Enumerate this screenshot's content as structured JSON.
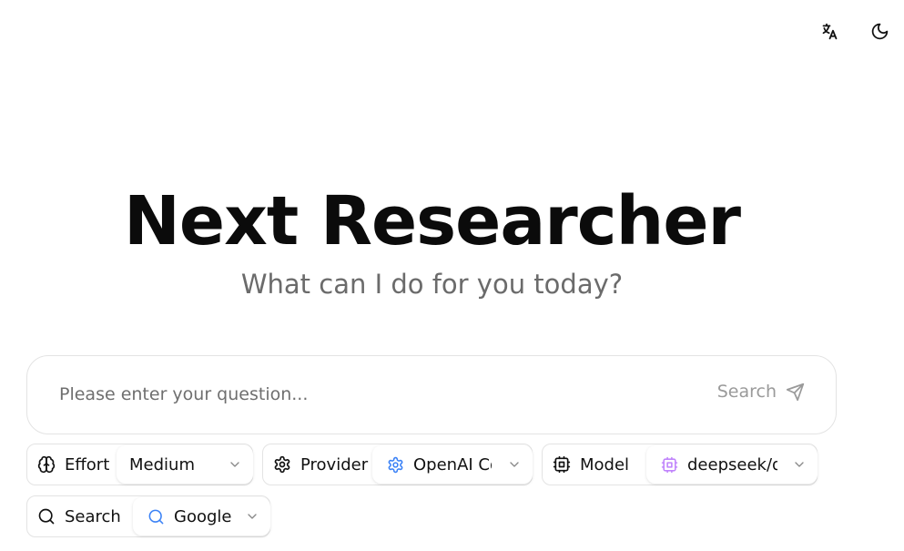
{
  "header": {
    "translate_icon": "translate-icon",
    "theme_icon": "moon-icon"
  },
  "hero": {
    "title": "Next Researcher",
    "subtitle": "What can I do for you today?"
  },
  "search": {
    "placeholder": "Please enter your question...",
    "value": "",
    "submit_label": "Search",
    "submit_icon": "send-icon"
  },
  "options": {
    "effort": {
      "label": "Effort",
      "icon": "brain-icon",
      "value": "Medium"
    },
    "provider": {
      "label": "Provider",
      "icon": "gear-icon",
      "value": "OpenAI Compatible",
      "value_icon": "gear-icon"
    },
    "model": {
      "label": "Model",
      "icon": "cpu-icon",
      "value": "deepseek/deepseek",
      "value_icon": "cpu-icon"
    },
    "search_engine": {
      "label": "Search",
      "icon": "search-icon",
      "value": "Google",
      "value_icon": "search-icon"
    }
  },
  "colors": {
    "provider_icon": "#3b82f6",
    "model_icon": "#c084fc",
    "search_icon": "#3b82f6",
    "border": "#e3e3e3",
    "muted_text": "#6b6b6b"
  }
}
